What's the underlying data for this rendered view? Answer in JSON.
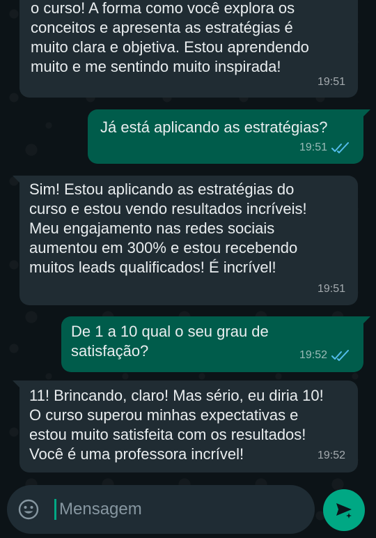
{
  "messages": [
    {
      "direction": "incoming",
      "text": "o curso! A forma como você explora os\nconceitos e apresenta as estratégias é\nmuito clara e objetiva. Estou aprendendo\nmuito e me sentindo muito inspirada!",
      "time": "19:51"
    },
    {
      "direction": "outgoing",
      "text": "Já está aplicando as estratégias?",
      "time": "19:51",
      "status": "read"
    },
    {
      "direction": "incoming",
      "text": "Sim! Estou aplicando as estratégias do\ncurso e estou vendo resultados incríveis!\nMeu engajamento nas redes sociais\naumentou em 300% e estou recebendo\nmuitos leads qualificados! É incrível!",
      "time": "19:51"
    },
    {
      "direction": "outgoing",
      "text": "De 1 a 10 qual o seu grau de\nsatisfação?",
      "time": "19:52",
      "status": "read"
    },
    {
      "direction": "incoming",
      "text": "11! Brincando, claro! Mas sério, eu diria 10!\nO curso superou minhas expectativas e\nestou muito satisfeita com os resultados!\nVocê é uma professora incrível!",
      "time": "19:52"
    }
  ],
  "composer": {
    "placeholder": "Mensagem",
    "emoji_icon": "emoji-icon",
    "send_icon": "send-icon"
  },
  "colors": {
    "background": "#0b141a",
    "incoming_bubble": "#202c33",
    "outgoing_bubble": "#005c4b",
    "accent": "#00a884",
    "read_ticks": "#53bdeb"
  }
}
